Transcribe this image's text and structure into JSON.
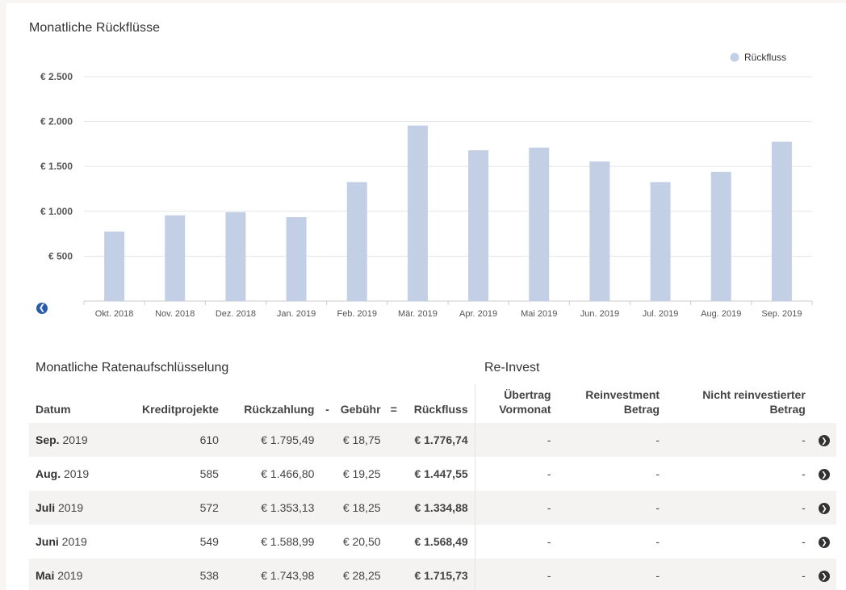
{
  "chart_data": {
    "type": "bar",
    "title": "Monatliche Rückflüsse",
    "categories": [
      "Okt. 2018",
      "Nov. 2018",
      "Dez. 2018",
      "Jan. 2019",
      "Feb. 2019",
      "Mär. 2019",
      "Apr. 2019",
      "Mai 2019",
      "Jun. 2019",
      "Jul. 2019",
      "Aug. 2019",
      "Sep. 2019"
    ],
    "series": [
      {
        "name": "Rückfluss",
        "values": [
          775,
          955,
          990,
          935,
          1325,
          1955,
          1680,
          1710,
          1555,
          1325,
          1440,
          1775
        ],
        "color": "#c3cfe5"
      }
    ],
    "yticks": [
      "€ 500",
      "€ 1.000",
      "€ 1.500",
      "€ 2.000",
      "€ 2.500"
    ],
    "ytick_values": [
      500,
      1000,
      1500,
      2000,
      2500
    ],
    "ylim": [
      0,
      2500
    ],
    "grid": true,
    "legend": "top-right"
  },
  "section_left_title": "Monatliche Ratenaufschlüsselung",
  "section_right_title": "Re-Invest",
  "table": {
    "headers": {
      "date": "Datum",
      "projects": "Kreditprojekte",
      "repayment": "Rückzahlung",
      "minus": "-",
      "fee": "Gebühr",
      "equals": "=",
      "return": "Rückfluss",
      "carry_1": "Übertrag",
      "carry_2": "Vormonat",
      "reinvest_1": "Reinvestment",
      "reinvest_2": "Betrag",
      "notreinvest_1": "Nicht reinvestierter",
      "notreinvest_2": "Betrag"
    },
    "rows": [
      {
        "month": "Sep.",
        "year": "2019",
        "projects": "610",
        "repayment": "€ 1.795,49",
        "fee": "€ 18,75",
        "return": "€ 1.776,74",
        "carry": "-",
        "reinvest": "-",
        "notreinvest": "-"
      },
      {
        "month": "Aug.",
        "year": "2019",
        "projects": "585",
        "repayment": "€ 1.466,80",
        "fee": "€ 19,25",
        "return": "€ 1.447,55",
        "carry": "-",
        "reinvest": "-",
        "notreinvest": "-"
      },
      {
        "month": "Juli",
        "year": "2019",
        "projects": "572",
        "repayment": "€ 1.353,13",
        "fee": "€ 18,25",
        "return": "€ 1.334,88",
        "carry": "-",
        "reinvest": "-",
        "notreinvest": "-"
      },
      {
        "month": "Juni",
        "year": "2019",
        "projects": "549",
        "repayment": "€ 1.588,99",
        "fee": "€ 20,50",
        "return": "€ 1.568,49",
        "carry": "-",
        "reinvest": "-",
        "notreinvest": "-"
      },
      {
        "month": "Mai",
        "year": "2019",
        "projects": "538",
        "repayment": "€ 1.743,98",
        "fee": "€ 28,25",
        "return": "€ 1.715,73",
        "carry": "-",
        "reinvest": "-",
        "notreinvest": "-"
      }
    ]
  }
}
